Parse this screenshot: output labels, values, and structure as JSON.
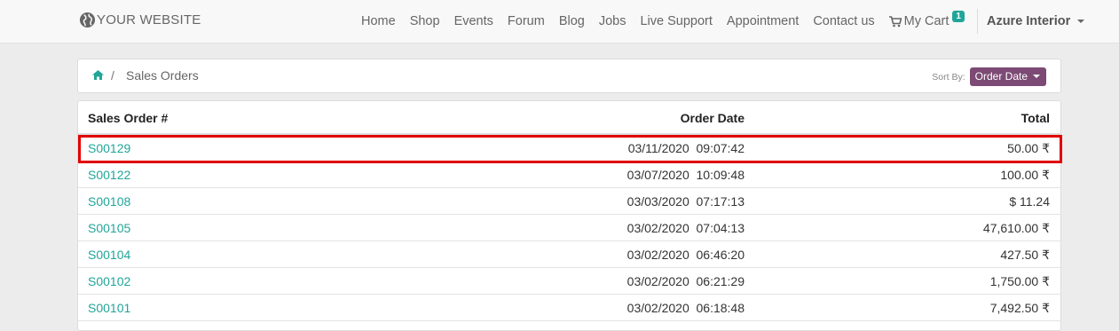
{
  "navbar": {
    "brand": "YOUR WEBSITE",
    "items": [
      "Home",
      "Shop",
      "Events",
      "Forum",
      "Blog",
      "Jobs",
      "Live Support",
      "Appointment",
      "Contact us"
    ],
    "cart_label": "My Cart",
    "cart_count": "1",
    "user": "Azure Interior"
  },
  "breadcrumb": {
    "current": "Sales Orders"
  },
  "sort": {
    "label": "Sort By:",
    "value": "Order Date"
  },
  "table": {
    "headers": {
      "order": "Sales Order #",
      "date": "Order Date",
      "total": "Total"
    },
    "rows": [
      {
        "order": "S00129",
        "date": "03/11/2020  09:07:42",
        "total": "50.00 ₹"
      },
      {
        "order": "S00122",
        "date": "03/07/2020  10:09:48",
        "total": "100.00 ₹"
      },
      {
        "order": "S00108",
        "date": "03/03/2020  07:17:13",
        "total": "$ 11.24"
      },
      {
        "order": "S00105",
        "date": "03/02/2020  07:04:13",
        "total": "47,610.00 ₹"
      },
      {
        "order": "S00104",
        "date": "03/02/2020  06:46:20",
        "total": "427.50 ₹"
      },
      {
        "order": "S00102",
        "date": "03/02/2020  06:21:29",
        "total": "1,750.00 ₹"
      },
      {
        "order": "S00101",
        "date": "03/02/2020  06:18:48",
        "total": "7,492.50 ₹"
      }
    ]
  },
  "colors": {
    "accent": "#21a599",
    "sort_button": "#7c4a74",
    "highlight": "#e00000"
  }
}
